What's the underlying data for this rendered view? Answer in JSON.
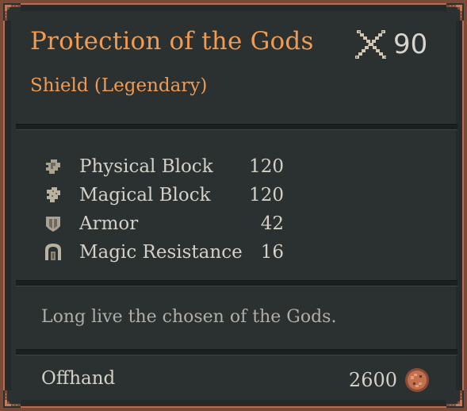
{
  "item": {
    "name": "Protection of the Gods",
    "type_line": "Shield (Legendary)",
    "level": "90",
    "level_icon": "crossed-swords-icon"
  },
  "stats": [
    {
      "label": "Physical Block",
      "value": "120",
      "icon": "physical-block-icon"
    },
    {
      "label": "Magical Block",
      "value": "120",
      "icon": "magical-block-icon"
    },
    {
      "label": "Armor",
      "value": "42",
      "icon": "armor-icon"
    },
    {
      "label": "Magic Resistance",
      "value": "16",
      "icon": "magic-resistance-icon"
    }
  ],
  "description": "Long live the chosen of the Gods.",
  "footer": {
    "slot": "Offhand",
    "price": "2600",
    "currency_icon": "gold-coin-icon"
  },
  "colors": {
    "title": "#f19a51",
    "text": "#d3d0c8",
    "description": "#b0aea6",
    "border": "#b36f55",
    "background": "#2b3130"
  }
}
